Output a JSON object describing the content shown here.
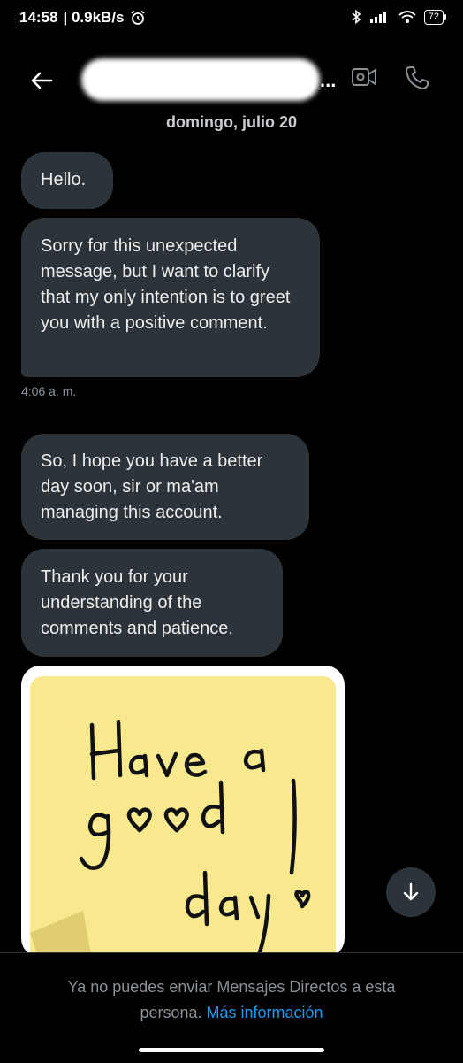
{
  "status": {
    "time": "14:58",
    "speed": "| 0.9kB/s",
    "battery": "72"
  },
  "header": {
    "more": "..."
  },
  "date": "domingo, julio 20",
  "messages": [
    {
      "text": "Hello."
    },
    {
      "text": "Sorry for this unexpected message, but I want to clarify that my only intention is to greet you with a positive comment."
    },
    {
      "text": "So, I hope you have a better day soon, sir or ma'am managing this account."
    },
    {
      "text": "Thank you for your understanding of the comments and patience."
    }
  ],
  "timestamp": "4:06 a. m.",
  "photo_text": "Have a good day!",
  "footer": {
    "notice": "Ya no puedes enviar Mensajes Directos a esta persona.",
    "link": "Más información"
  },
  "colors": {
    "background": "#000000",
    "bubble": "#2c3339",
    "link": "#1d9bf0",
    "note": "#f8e88e"
  }
}
